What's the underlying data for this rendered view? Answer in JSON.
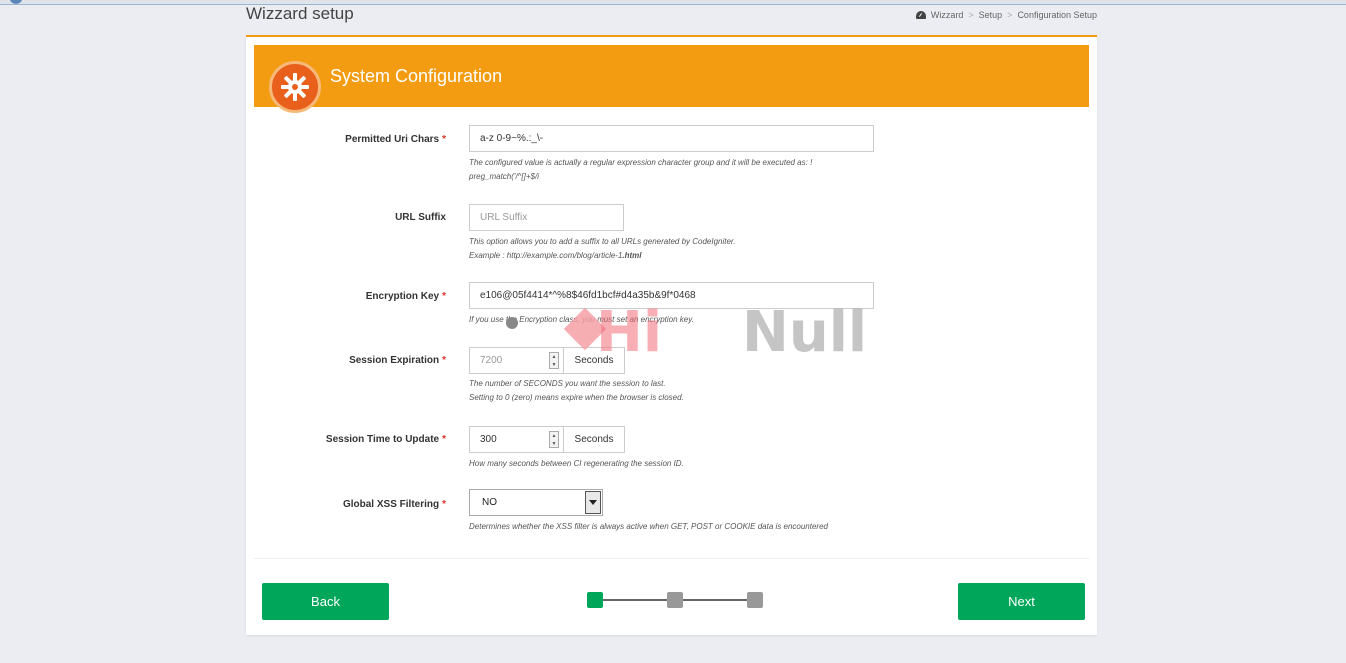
{
  "page": {
    "title": "Wizzard setup",
    "breadcrumb": [
      "Wizzard",
      "Setup",
      "Configuration Setup"
    ]
  },
  "banner": {
    "title": "System Configuration"
  },
  "fields": {
    "permitted_uri_chars": {
      "label": "Permitted Uri Chars",
      "required": "*",
      "value": "a-z 0-9~%.:_\\-",
      "help_line1": "The configured value is actually a regular expression character group and it will be executed as: !",
      "help_line2": "preg_match('/^[]+$/i"
    },
    "url_suffix": {
      "label": "URL Suffix",
      "placeholder": "URL Suffix",
      "help_line1": "This option allows you to add a suffix to all URLs generated by CodeIgniter.",
      "help_line2_prefix": "Example : http://example.com/blog/article-1",
      "help_line2_bold": ".html"
    },
    "encryption_key": {
      "label": "Encryption Key",
      "required": "*",
      "value": "e106@05f4414*^%8$46fd1bcf#d4a35b&9f*0468",
      "help": "If you use the Encryption class, you must set an encryption key."
    },
    "session_expiration": {
      "label": "Session Expiration",
      "required": "*",
      "value": "7200",
      "unit": "Seconds",
      "help_line1": "The number of SECONDS you want the session to last.",
      "help_line2": "Setting to 0 (zero) means expire when the browser is closed."
    },
    "session_time_to_update": {
      "label": "Session Time to Update",
      "required": "*",
      "value": "300",
      "unit": "Seconds",
      "help": "How many seconds between CI regenerating the session ID."
    },
    "global_xss_filtering": {
      "label": "Global XSS Filtering",
      "required": "*",
      "selected": "NO",
      "help": "Determines whether the XSS filter is always active when GET, POST or COOKIE data is encountered"
    }
  },
  "buttons": {
    "back": "Back",
    "next": "Next"
  },
  "wizard_steps": {
    "total": 3,
    "current": 1
  },
  "watermark": {
    "text1": "Hi",
    "text2": "Null"
  },
  "colors": {
    "banner": "#f39c12",
    "gear_circle": "#e8601c",
    "button": "#00a65a",
    "required": "#d9322b"
  }
}
